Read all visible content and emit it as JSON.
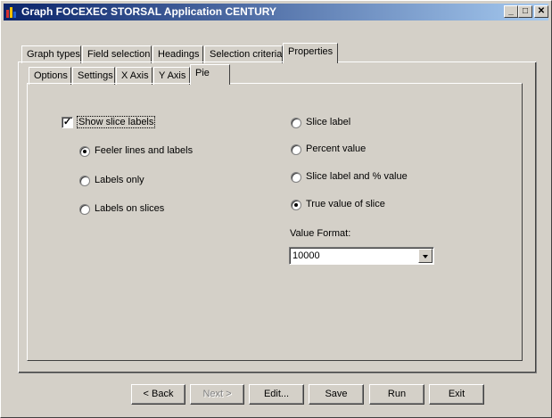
{
  "window": {
    "title": "Graph FOCEXEC STORSAL Application CENTURY",
    "controls": {
      "minimize": "_",
      "maximize": "□",
      "close": "✕"
    }
  },
  "main_tabs": [
    {
      "label": "Graph types"
    },
    {
      "label": "Field selection"
    },
    {
      "label": "Headings"
    },
    {
      "label": "Selection criteria"
    },
    {
      "label": "Properties"
    }
  ],
  "sub_tabs": [
    {
      "label": "Options"
    },
    {
      "label": "Settings"
    },
    {
      "label": "X Axis"
    },
    {
      "label": "Y Axis"
    },
    {
      "label": "Pie"
    }
  ],
  "pie": {
    "show_slice_labels": {
      "label": "Show slice labels",
      "checked": true,
      "mark": "✓"
    },
    "label_style": [
      {
        "label": "Feeler lines and labels",
        "checked": true
      },
      {
        "label": "Labels only",
        "checked": false
      },
      {
        "label": "Labels on slices",
        "checked": false
      }
    ],
    "label_content": [
      {
        "label": "Slice label",
        "checked": false
      },
      {
        "label": "Percent value",
        "checked": false
      },
      {
        "label": "Slice label and % value",
        "checked": false
      },
      {
        "label": "True value of slice",
        "checked": true
      }
    ],
    "value_format": {
      "label": "Value Format:",
      "value": "10000"
    }
  },
  "buttons": {
    "back": "< Back",
    "next": "Next >",
    "edit": "Edit...",
    "save": "Save",
    "run": "Run",
    "exit": "Exit"
  },
  "icon_colors": [
    "#d83030",
    "#f0c000",
    "#2060d0",
    "#30a030"
  ]
}
